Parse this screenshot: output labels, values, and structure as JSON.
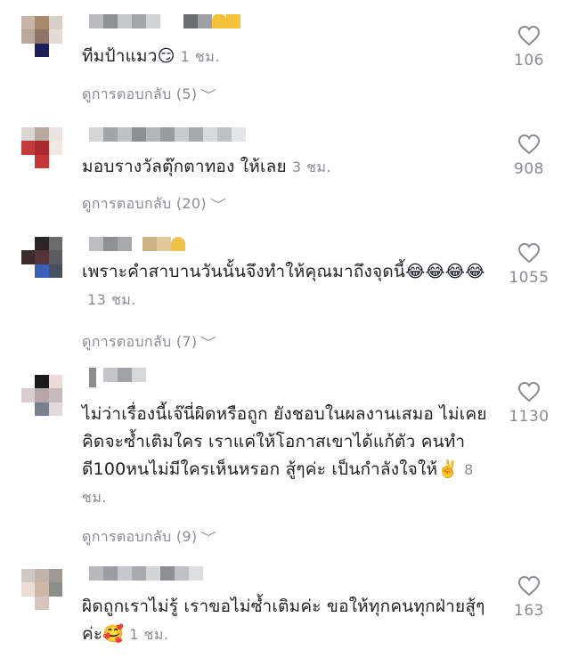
{
  "comments": [
    {
      "text": "ทีมป้าแมว",
      "emoji": "😏",
      "time": "1 ชม.",
      "replies": "ดูการตอบกลับ (5)",
      "likes": "106"
    },
    {
      "text": "มอบรางวัลตุ๊กตาทอง ให้เลย",
      "emoji": "",
      "time": "3 ชม.",
      "replies": "ดูการตอบกลับ (20)",
      "likes": "908"
    },
    {
      "text": "เพราะคำสาบานวันนั้นจึงทำให้คุณมาถึงจุดนี้",
      "emoji": "😂😂😂😂",
      "time": "13 ชม.",
      "replies": "ดูการตอบกลับ (7)",
      "likes": "1055"
    },
    {
      "text": "ไม่ว่าเรื่องนี้เจ๊นี่ผิดหรือถูก ยังชอบในผลงานเสมอ ไม่เคยคิดจะซ้ำเติมใคร เราแค่ให้โอกาสเขาได้แก้ตัว คนทำดี100หนไม่มีใครเห็นหรอก สู้ๆค่ะ เป็นกำลังใจให้",
      "emoji": "✌️",
      "time": "8 ชม.",
      "replies": "ดูการตอบกลับ (9)",
      "likes": "1130"
    },
    {
      "text": "ผิดถูกเราไม่รู้ เราขอไม่ซ้ำเติมค่ะ ขอให้ทุกคนทุกฝ่ายสู้ๆค่ะ",
      "emoji": "🥰",
      "time": "1 ชม.",
      "replies": "",
      "likes": "163"
    }
  ],
  "icons": {
    "like": "heart-icon",
    "expand": "chevron-down-icon"
  },
  "colors": {
    "muted": "#8a8b91",
    "text": "#161823"
  }
}
